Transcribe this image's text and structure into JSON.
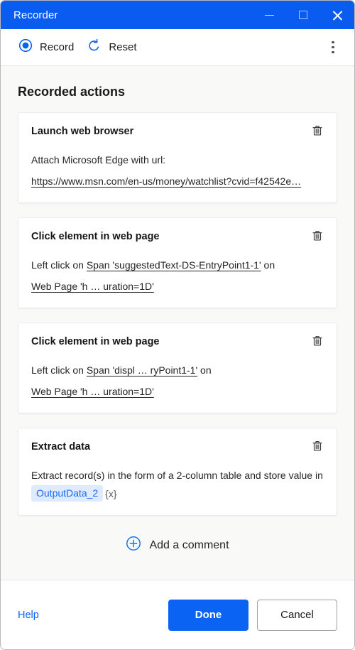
{
  "window": {
    "title": "Recorder",
    "controls": {
      "minimize": "minimize",
      "maximize": "maximize",
      "close": "close"
    }
  },
  "toolbar": {
    "record_label": "Record",
    "reset_label": "Reset",
    "more_label": "More options"
  },
  "main": {
    "section_title": "Recorded actions",
    "add_comment_label": "Add a comment",
    "cards": [
      {
        "title": "Launch web browser",
        "desc_prefix": "Attach Microsoft Edge with url:",
        "url": "https://www.msn.com/en-us/money/watchlist?cvid=f42542e…",
        "delete_label": "Delete"
      },
      {
        "title": "Click element in web page",
        "desc_prefix": "Left click on",
        "target": "Span 'suggestedText-DS-EntryPoint1-1'",
        "desc_mid": "on",
        "page": "Web Page 'h … uration=1D'",
        "delete_label": "Delete"
      },
      {
        "title": "Click element in web page",
        "desc_prefix": "Left click on",
        "target": "Span 'displ … ryPoint1-1'",
        "desc_mid": "on",
        "page": "Web Page 'h … uration=1D'",
        "delete_label": "Delete"
      },
      {
        "title": "Extract data",
        "desc_prefix": "Extract record(s) in the form of a 2-column table and store value in",
        "variable": "OutputData_2",
        "variable_type": "{x}",
        "delete_label": "Delete"
      }
    ]
  },
  "footer": {
    "help_label": "Help",
    "done_label": "Done",
    "cancel_label": "Cancel"
  },
  "colors": {
    "titlebar": "#0a5cf0",
    "accent": "#0b63f3",
    "page_bg": "#f9f9f8",
    "card_bg": "#ffffff",
    "chip_bg": "#dfeafc",
    "chip_text": "#1a6cf5"
  }
}
